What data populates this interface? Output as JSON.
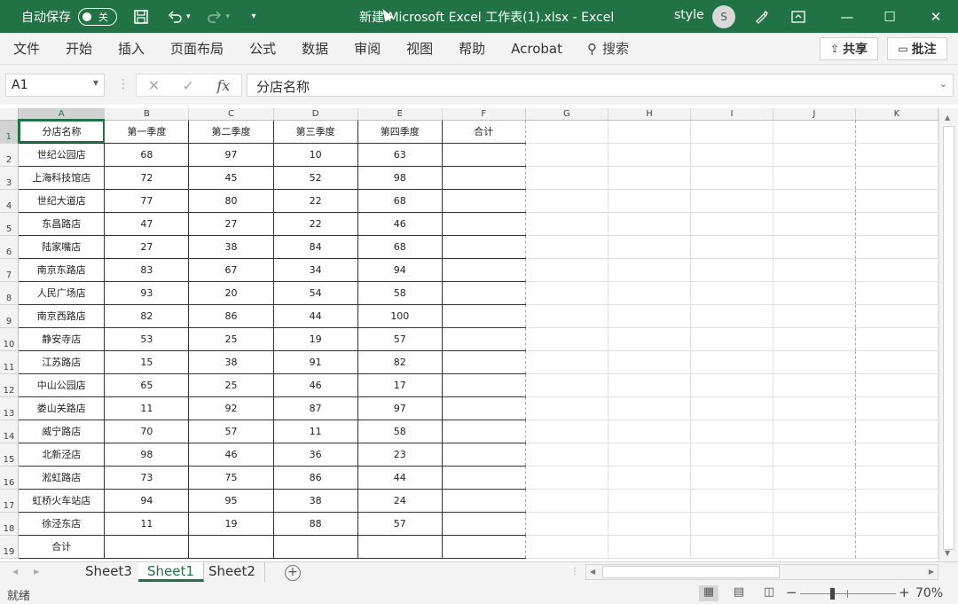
{
  "titlebar": {
    "autosave_label": "自动保存",
    "autosave_state": "关",
    "title": "新建 Microsoft Excel 工作表(1).xlsx  -  Excel",
    "user": "style",
    "avatar_initial": "S"
  },
  "ribbon": {
    "tabs": [
      "文件",
      "开始",
      "插入",
      "页面布局",
      "公式",
      "数据",
      "审阅",
      "视图",
      "帮助",
      "Acrobat"
    ],
    "search_label": "搜索",
    "share_label": "共享",
    "comment_label": "批注"
  },
  "formula_bar": {
    "name_box": "A1",
    "content": "分店名称"
  },
  "columns": [
    "A",
    "B",
    "C",
    "D",
    "E",
    "F",
    "G",
    "H",
    "I",
    "J",
    "K"
  ],
  "row_numbers": [
    "1",
    "2",
    "3",
    "4",
    "5",
    "6",
    "7",
    "8",
    "9",
    "10",
    "11",
    "12",
    "13",
    "14",
    "15",
    "16",
    "17",
    "18",
    "19"
  ],
  "sheet": {
    "headers": [
      "分店名称",
      "第一季度",
      "第二季度",
      "第三季度",
      "第四季度",
      "合计"
    ],
    "rows": [
      [
        "世纪公园店",
        "68",
        "97",
        "10",
        "63",
        ""
      ],
      [
        "上海科技馆店",
        "72",
        "45",
        "52",
        "98",
        ""
      ],
      [
        "世纪大道店",
        "77",
        "80",
        "22",
        "68",
        ""
      ],
      [
        "东昌路店",
        "47",
        "27",
        "22",
        "46",
        ""
      ],
      [
        "陆家嘴店",
        "27",
        "38",
        "84",
        "68",
        ""
      ],
      [
        "南京东路店",
        "83",
        "67",
        "34",
        "94",
        ""
      ],
      [
        "人民广场店",
        "93",
        "20",
        "54",
        "58",
        ""
      ],
      [
        "南京西路店",
        "82",
        "86",
        "44",
        "100",
        ""
      ],
      [
        "静安寺店",
        "53",
        "25",
        "19",
        "57",
        ""
      ],
      [
        "江苏路店",
        "15",
        "38",
        "91",
        "82",
        ""
      ],
      [
        "中山公园店",
        "65",
        "25",
        "46",
        "17",
        ""
      ],
      [
        "娄山关路店",
        "11",
        "92",
        "87",
        "97",
        ""
      ],
      [
        "威宁路店",
        "70",
        "57",
        "11",
        "58",
        ""
      ],
      [
        "北新泾店",
        "98",
        "46",
        "36",
        "23",
        ""
      ],
      [
        "淞虹路店",
        "73",
        "75",
        "86",
        "44",
        ""
      ],
      [
        "虹桥火车站店",
        "94",
        "95",
        "38",
        "24",
        ""
      ],
      [
        "徐泾东店",
        "11",
        "19",
        "88",
        "57",
        ""
      ],
      [
        "合计",
        "",
        "",
        "",
        "",
        ""
      ]
    ]
  },
  "sheet_tabs": [
    "Sheet3",
    "Sheet1",
    "Sheet2"
  ],
  "active_sheet": "Sheet1",
  "status": {
    "ready": "就绪",
    "zoom": "70%"
  },
  "colors": {
    "accent": "#217346",
    "chrome": "#f3f3f3"
  }
}
